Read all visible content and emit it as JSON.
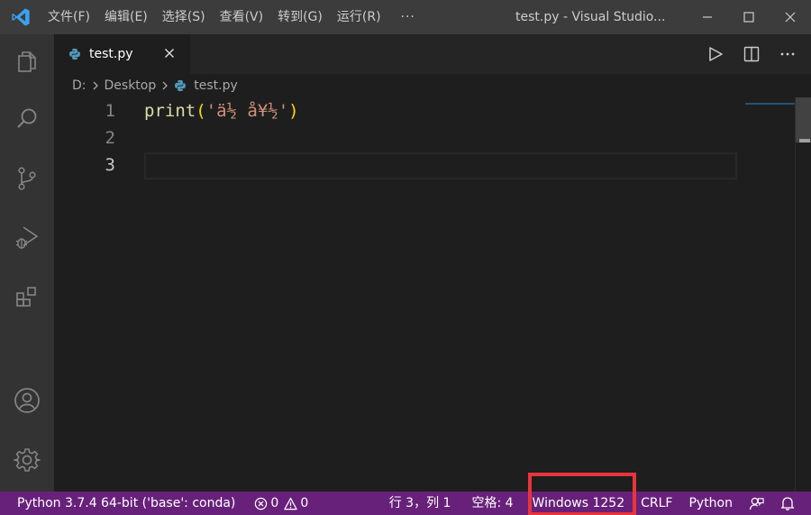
{
  "titlebar": {
    "menu": [
      "文件(F)",
      "编辑(E)",
      "选择(S)",
      "查看(V)",
      "转到(G)",
      "运行(R)"
    ],
    "more": "···",
    "window_title": "test.py - Visual Studio..."
  },
  "tabs": [
    {
      "label": "test.py"
    }
  ],
  "breadcrumb": {
    "drive": "D:",
    "folder": "Desktop",
    "file": "test.py"
  },
  "editor": {
    "line_numbers": [
      "1",
      "2",
      "3"
    ],
    "line1": {
      "fn": "print",
      "open": "(",
      "str": "'ä½ å¥½'",
      "close": ")"
    }
  },
  "statusbar": {
    "interpreter": "Python 3.7.4 64-bit ('base': conda)",
    "errors": "0",
    "warnings": "0",
    "position": "行 3，列 1",
    "spaces": "空格: 4",
    "encoding": "Windows 1252",
    "eol": "CRLF",
    "language": "Python"
  },
  "colors": {
    "titlebar": "#3c3c3c",
    "activitybar": "#333333",
    "editor_bg": "#1e1e1e",
    "statusbar": "#68217a",
    "highlight": "#e8343b",
    "vscode_blue": "#3ca0f0"
  },
  "icons": {
    "activity": [
      "files-icon",
      "search-icon",
      "source-control-icon",
      "run-debug-icon",
      "extensions-icon",
      "account-icon",
      "settings-gear-icon"
    ]
  }
}
